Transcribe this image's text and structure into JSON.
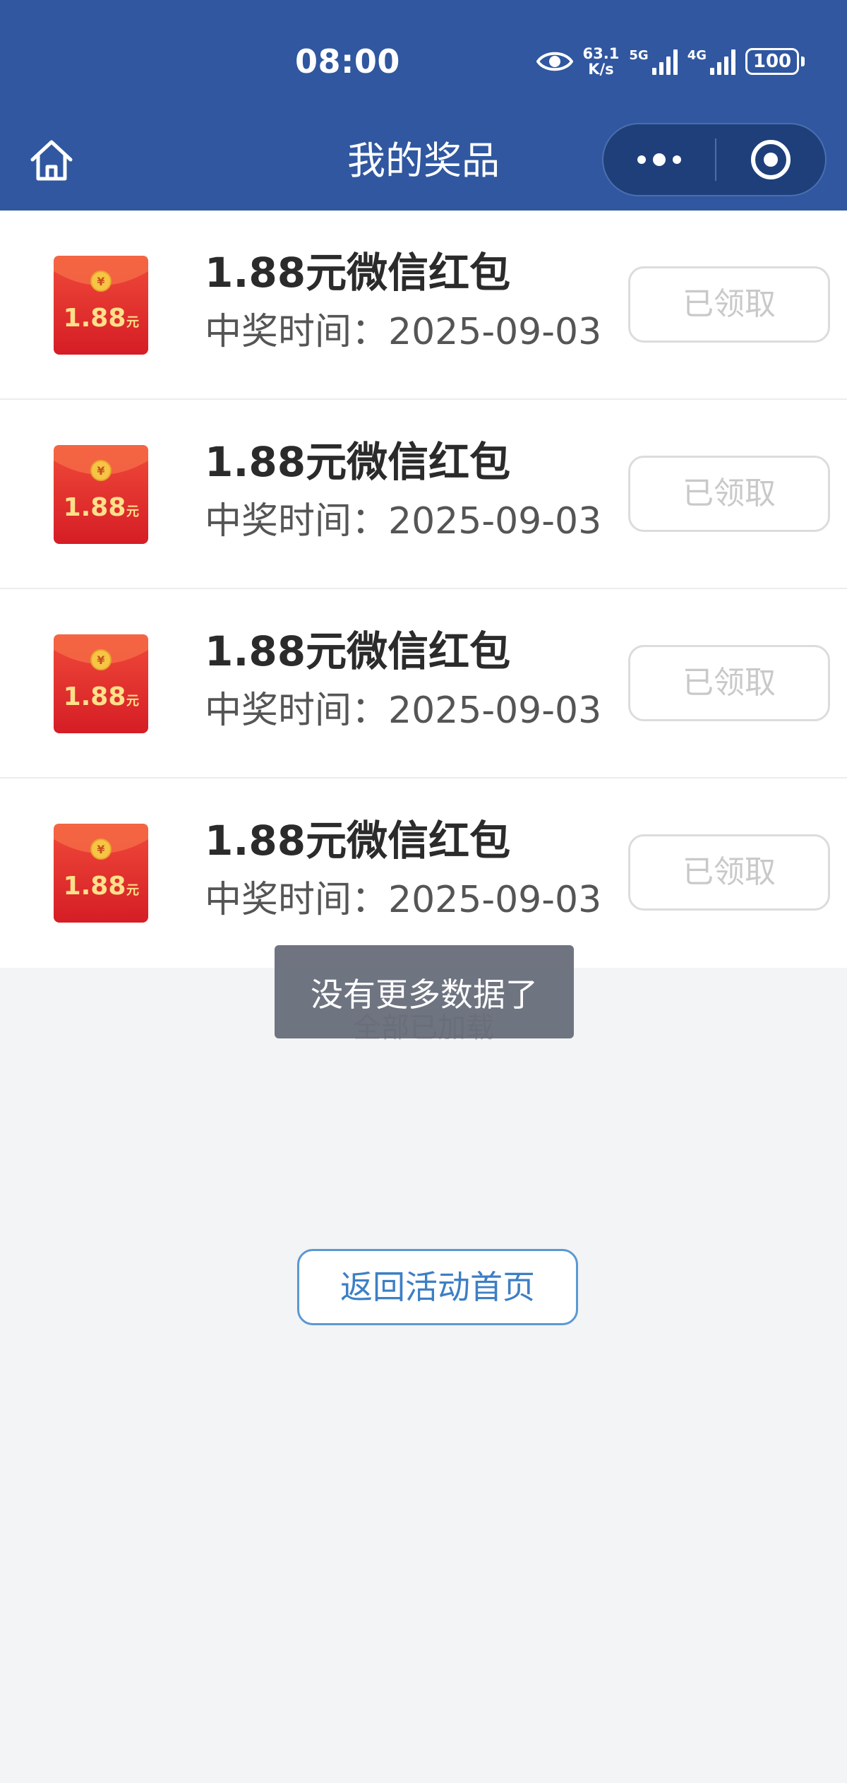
{
  "status_bar": {
    "time": "08:00",
    "net_speed_value": "63.1",
    "net_speed_unit": "K/s",
    "signal1_label": "5G",
    "signal2_label": "4G",
    "battery": "100"
  },
  "nav": {
    "title": "我的奖品"
  },
  "prizes": [
    {
      "envelope_amount": "1.88",
      "envelope_unit": "元",
      "name": "1.88元微信红包",
      "time": "中奖时间：2025-09-03",
      "status": "已领取"
    },
    {
      "envelope_amount": "1.88",
      "envelope_unit": "元",
      "name": "1.88元微信红包",
      "time": "中奖时间：2025-09-03",
      "status": "已领取"
    },
    {
      "envelope_amount": "1.88",
      "envelope_unit": "元",
      "name": "1.88元微信红包",
      "time": "中奖时间：2025-09-03",
      "status": "已领取"
    },
    {
      "envelope_amount": "1.88",
      "envelope_unit": "元",
      "name": "1.88元微信红包",
      "time": "中奖时间：2025-09-03",
      "status": "已领取"
    }
  ],
  "list_end_text": "全部已加载",
  "toast": "没有更多数据了",
  "back_button": "返回活动首页",
  "colors": {
    "header": "#3057a0",
    "page_bg": "#f3f4f6",
    "envelope_red": "#e42a2a",
    "back_button": "#3d7fc4"
  }
}
